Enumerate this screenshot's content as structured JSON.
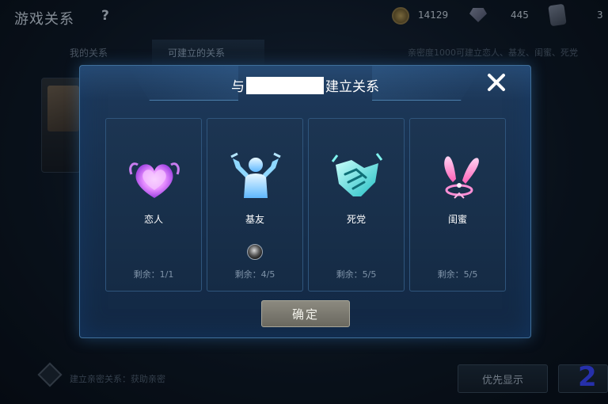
{
  "header": {
    "title": "游戏关系",
    "help_symbol": "?",
    "coins": "14129",
    "gems": "445",
    "tickets": "3"
  },
  "tabs": {
    "mine": "我的关系",
    "available": "可建立的关系",
    "hint": "亲密度1000可建立恋人、基友、闺蜜、死党"
  },
  "bottom": {
    "hint": "建立亲密关系：获助亲密",
    "priority_label": "优先显示",
    "corner_mark": "2"
  },
  "modal": {
    "title_prefix": "与",
    "title_suffix": "建立关系",
    "confirm_label": "确定",
    "cards": [
      {
        "name": "恋人",
        "remaining": "剩余：1/1",
        "icon": "heart-icon",
        "color": "#e58cff"
      },
      {
        "name": "基友",
        "remaining": "剩余：4/5",
        "icon": "muscle-icon",
        "color": "#8fd8ff"
      },
      {
        "name": "死党",
        "remaining": "剩余：5/5",
        "icon": "handshake-icon",
        "color": "#4fe6e0"
      },
      {
        "name": "闺蜜",
        "remaining": "剩余：5/5",
        "icon": "bunny-ears-icon",
        "color": "#ff8fd6"
      }
    ]
  },
  "colors": {
    "modal_border": "#3f6f9a",
    "modal_bg": "#17304e",
    "confirm_bg": "#7a786f"
  }
}
